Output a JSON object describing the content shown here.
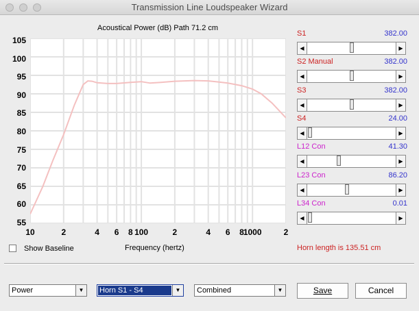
{
  "window": {
    "title": "Transmission Line Loudspeaker Wizard"
  },
  "chart": {
    "title": "Acoustical Power (dB)   Path 71.2 cm",
    "xlabel": "Frequency (hertz)",
    "y_ticks": [
      "105",
      "100",
      "95",
      "90",
      "85",
      "80",
      "75",
      "70",
      "65",
      "60",
      "55"
    ],
    "x_ticks": [
      {
        "label": "10",
        "f": 10
      },
      {
        "label": "2",
        "f": 20
      },
      {
        "label": "4",
        "f": 40
      },
      {
        "label": "6",
        "f": 60
      },
      {
        "label": "8",
        "f": 80
      },
      {
        "label": "100",
        "f": 100
      },
      {
        "label": "2",
        "f": 200
      },
      {
        "label": "4",
        "f": 400
      },
      {
        "label": "6",
        "f": 600
      },
      {
        "label": "8",
        "f": 800
      },
      {
        "label": "1000",
        "f": 1000
      },
      {
        "label": "2",
        "f": 2000
      }
    ],
    "curve_color": "#f4c0c0",
    "grid_color": "#e2e2e2"
  },
  "chart_data": {
    "type": "line",
    "title": "Acoustical Power (dB)   Path 71.2 cm",
    "xlabel": "Frequency (hertz)",
    "ylabel": "",
    "xscale": "log",
    "xlim": [
      10,
      2000
    ],
    "ylim": [
      55,
      105
    ],
    "grid": true,
    "series": [
      {
        "x": [
          10,
          13,
          16,
          20,
          25,
          30,
          33,
          36,
          40,
          50,
          60,
          80,
          100,
          120,
          150,
          200,
          300,
          400,
          500,
          600,
          800,
          1000,
          1200,
          1500,
          2000
        ],
        "y": [
          57.5,
          65,
          72,
          79,
          87,
          92.5,
          93.5,
          93.4,
          93,
          92.8,
          92.8,
          93.1,
          93.3,
          92.9,
          93.1,
          93.4,
          93.6,
          93.5,
          93.2,
          92.9,
          92.2,
          91.3,
          90,
          87.5,
          83.5
        ]
      }
    ]
  },
  "baseline": {
    "label": "Show Baseline",
    "checked": false
  },
  "sliders": [
    {
      "label": "S1",
      "value": "382.00",
      "color": "#cc2222",
      "pos": 0.5
    },
    {
      "label": "S2  Manual",
      "value": "382.00",
      "color": "#cc2222",
      "pos": 0.5
    },
    {
      "label": "S3",
      "value": "382.00",
      "color": "#cc2222",
      "pos": 0.5
    },
    {
      "label": "S4",
      "value": "24.00",
      "color": "#cc2222",
      "pos": 0.0
    },
    {
      "label": "L12  Con",
      "value": "41.30",
      "color": "#cc22cc",
      "pos": 0.35
    },
    {
      "label": "L23  Con",
      "value": "86.20",
      "color": "#cc22cc",
      "pos": 0.45
    },
    {
      "label": "L34  Con",
      "value": "0.01",
      "color": "#cc22cc",
      "pos": 0.0
    }
  ],
  "value_color": "#3333cc",
  "horn_length": "Horn length is 135.51 cm",
  "selects": {
    "type": "Power",
    "section": "Horn S1 - S4",
    "mode": "Combined"
  },
  "buttons": {
    "save": "Save",
    "cancel": "Cancel"
  }
}
